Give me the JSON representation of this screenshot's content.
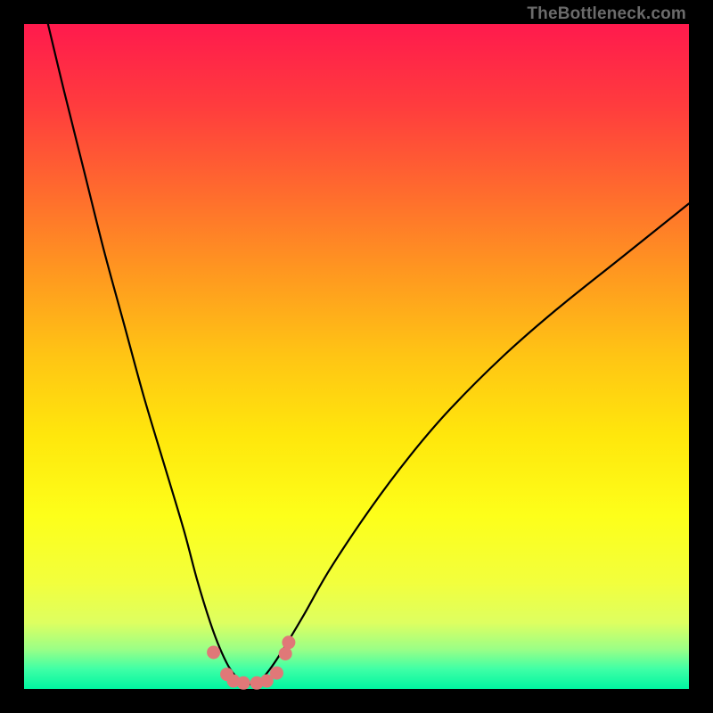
{
  "watermark": "TheBottleneck.com",
  "chart_data": {
    "type": "line",
    "title": "",
    "xlabel": "",
    "ylabel": "",
    "xlim": [
      0,
      100
    ],
    "ylim": [
      0,
      100
    ],
    "grid": false,
    "legend": false,
    "series": [
      {
        "name": "curve",
        "color": "#000000",
        "x": [
          3.6,
          6,
          9,
          12,
          15,
          18,
          21,
          24,
          26,
          28,
          29.5,
          31,
          32.5,
          34,
          35.5,
          37,
          39,
          42,
          46,
          52,
          58,
          64,
          72,
          80,
          90,
          100
        ],
        "y": [
          100,
          90,
          78,
          66,
          55,
          44,
          34,
          24,
          16.5,
          10,
          6,
          3,
          1.3,
          0.7,
          1.3,
          3,
          6,
          11,
          18,
          27,
          35,
          42,
          50,
          57,
          65,
          73
        ]
      },
      {
        "name": "markers",
        "type": "scatter",
        "color": "#e07878",
        "x": [
          28.5,
          30.5,
          31.5,
          33,
          35,
          36.5,
          38,
          39.3,
          39.8
        ],
        "y": [
          5.5,
          2.2,
          1.2,
          0.9,
          0.9,
          1.2,
          2.4,
          5.3,
          7.0
        ]
      }
    ]
  }
}
